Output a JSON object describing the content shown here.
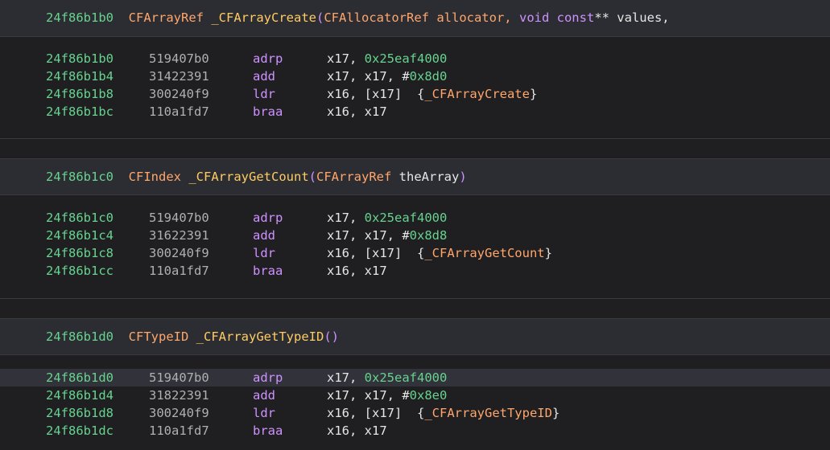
{
  "functions": [
    {
      "address": "24f86b1b0",
      "return_type": "CFArrayRef",
      "name": "_CFArrayCreate",
      "params_prefix": "CFAllocatorRef allocator, ",
      "params_keyword": "void const",
      "params_suffix": "** values,",
      "instructions": [
        {
          "addr": "24f86b1b0",
          "bytes": "519407b0",
          "mnemonic": "adrp",
          "op1": "x17, ",
          "imm": "0x25eaf4000",
          "sym": ""
        },
        {
          "addr": "24f86b1b4",
          "bytes": "31422391",
          "mnemonic": "add",
          "op1": "x17, x17, #",
          "imm": "0x8d0",
          "sym": ""
        },
        {
          "addr": "24f86b1b8",
          "bytes": "300240f9",
          "mnemonic": "ldr",
          "op1": "x16, [x17]  {",
          "imm": "",
          "sym": "_CFArrayCreate"
        },
        {
          "addr": "24f86b1bc",
          "bytes": "110a1fd7",
          "mnemonic": "braa",
          "op1": "x16, x17",
          "imm": "",
          "sym": ""
        }
      ]
    },
    {
      "address": "24f86b1c0",
      "return_type": "CFIndex",
      "name": "_CFArrayGetCount",
      "params_prefix": "",
      "params_type": "CFArrayRef",
      "params_name": " theArray",
      "instructions": [
        {
          "addr": "24f86b1c0",
          "bytes": "519407b0",
          "mnemonic": "adrp",
          "op1": "x17, ",
          "imm": "0x25eaf4000",
          "sym": ""
        },
        {
          "addr": "24f86b1c4",
          "bytes": "31622391",
          "mnemonic": "add",
          "op1": "x17, x17, #",
          "imm": "0x8d8",
          "sym": ""
        },
        {
          "addr": "24f86b1c8",
          "bytes": "300240f9",
          "mnemonic": "ldr",
          "op1": "x16, [x17]  {",
          "imm": "",
          "sym": "_CFArrayGetCount"
        },
        {
          "addr": "24f86b1cc",
          "bytes": "110a1fd7",
          "mnemonic": "braa",
          "op1": "x16, x17",
          "imm": "",
          "sym": ""
        }
      ]
    },
    {
      "address": "24f86b1d0",
      "return_type": "CFTypeID",
      "name": "_CFArrayGetTypeID",
      "instructions": [
        {
          "addr": "24f86b1d0",
          "bytes": "519407b0",
          "mnemonic": "adrp",
          "op1": "x17, ",
          "imm": "0x25eaf4000",
          "sym": ""
        },
        {
          "addr": "24f86b1d4",
          "bytes": "31822391",
          "mnemonic": "add",
          "op1": "x17, x17, #",
          "imm": "0x8e0",
          "sym": ""
        },
        {
          "addr": "24f86b1d8",
          "bytes": "300240f9",
          "mnemonic": "ldr",
          "op1": "x16, [x17]  {",
          "imm": "",
          "sym": "_CFArrayGetTypeID"
        },
        {
          "addr": "24f86b1dc",
          "bytes": "110a1fd7",
          "mnemonic": "braa",
          "op1": "x16, x17",
          "imm": "",
          "sym": ""
        }
      ]
    }
  ],
  "punct": {
    "open_paren": "(",
    "close_paren": ")",
    "empty_parens": "()",
    "close_brace": "}"
  },
  "colors": {
    "background": "#1f1f22",
    "header_background": "#2c2d32",
    "selected_row": "#31323a",
    "address": "#67d38f",
    "type": "#ffa66b",
    "function_name": "#ffcc62",
    "keyword": "#ce92ff"
  }
}
